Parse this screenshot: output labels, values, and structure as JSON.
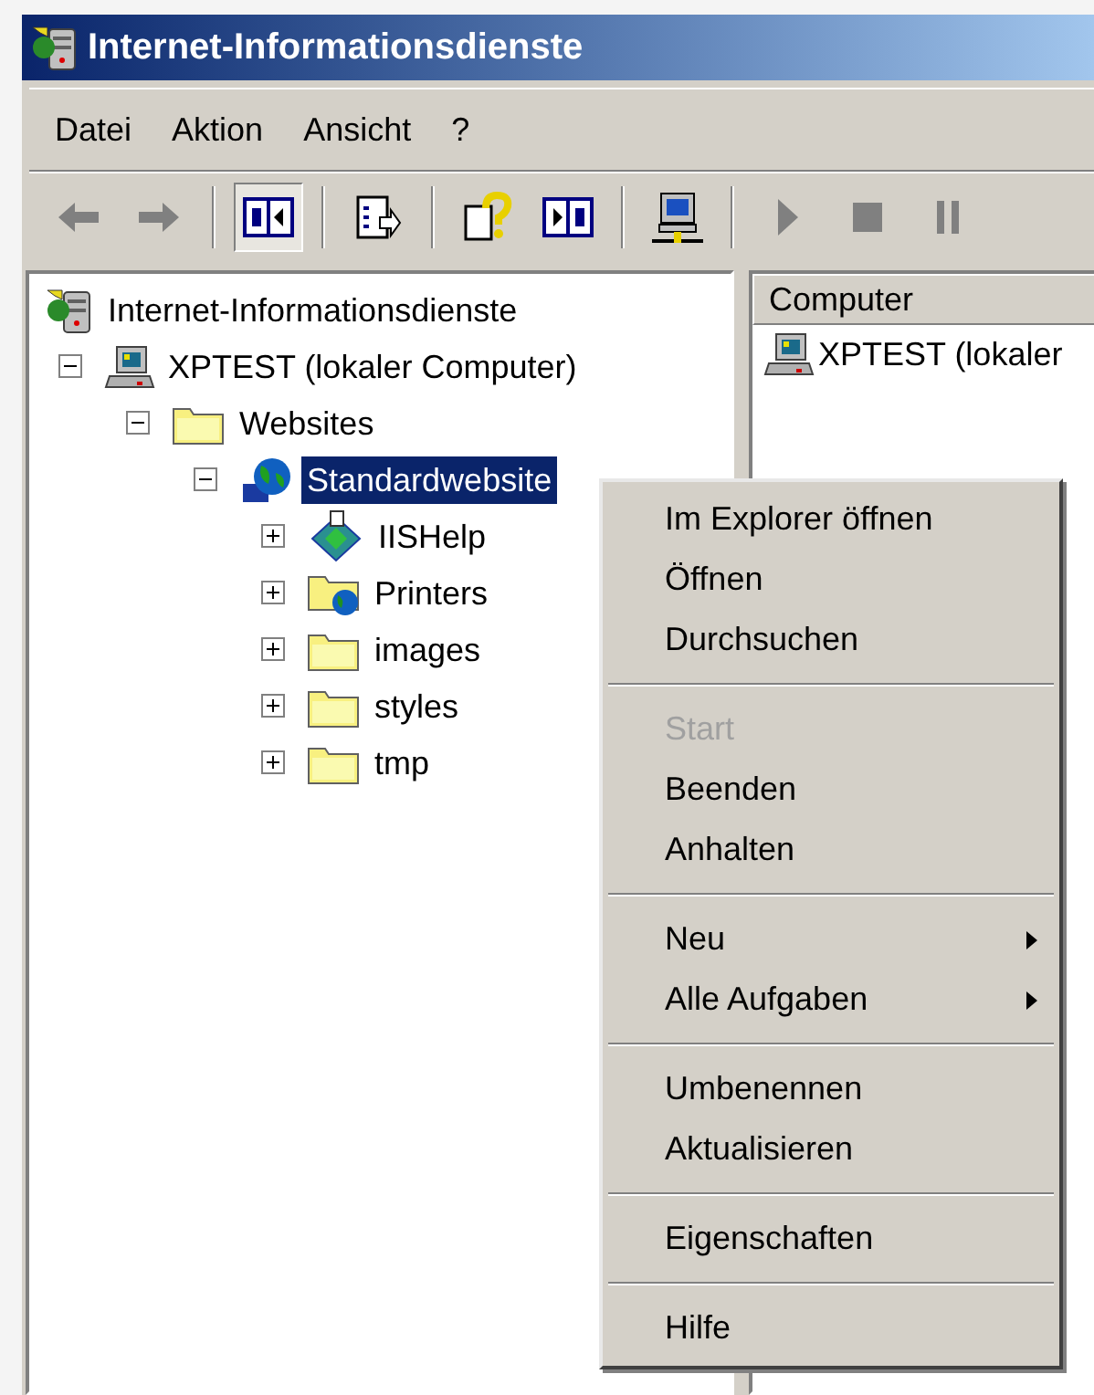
{
  "window": {
    "title": "Internet-Informationsdienste"
  },
  "menu_bar": [
    "Datei",
    "Aktion",
    "Ansicht",
    "?"
  ],
  "toolbar": [
    {
      "kind": "back",
      "disabled": true
    },
    {
      "kind": "forward",
      "disabled": true
    },
    {
      "kind": "separator"
    },
    {
      "kind": "tree",
      "pressed": true
    },
    {
      "kind": "separator"
    },
    {
      "kind": "export",
      "pressed": false
    },
    {
      "kind": "separator"
    },
    {
      "kind": "help",
      "pressed": false
    },
    {
      "kind": "pane",
      "pressed": false
    },
    {
      "kind": "separator"
    },
    {
      "kind": "computer",
      "pressed": false
    },
    {
      "kind": "separator"
    },
    {
      "kind": "play",
      "disabled": true
    },
    {
      "kind": "stop",
      "disabled": true
    },
    {
      "kind": "pause",
      "disabled": true
    }
  ],
  "tree": [
    {
      "label": "Internet-Informationsdienste",
      "kind": "iis",
      "selected": false,
      "children": [
        {
          "label": "XPTEST (lokaler Computer)",
          "kind": "computer",
          "selected": false,
          "expanded": true,
          "children": [
            {
              "label": "Websites",
              "kind": "folder",
              "selected": false,
              "expanded": true,
              "children": [
                {
                  "label": "Standardwebsite",
                  "kind": "site",
                  "selected": true,
                  "expanded": true,
                  "children": [
                    {
                      "label": "IISHelp",
                      "kind": "app",
                      "selected": false,
                      "expanded": false
                    },
                    {
                      "label": "Printers",
                      "kind": "webfolder",
                      "selected": false,
                      "expanded": false
                    },
                    {
                      "label": "images",
                      "kind": "folder",
                      "selected": false,
                      "expanded": false
                    },
                    {
                      "label": "styles",
                      "kind": "folder",
                      "selected": false,
                      "expanded": false
                    },
                    {
                      "label": "tmp",
                      "kind": "folder",
                      "selected": false,
                      "expanded": false
                    }
                  ]
                }
              ]
            }
          ]
        }
      ]
    }
  ],
  "list": {
    "columns": [
      "Computer"
    ],
    "rows": [
      {
        "label": "XPTEST (lokaler",
        "kind": "computer"
      }
    ]
  },
  "context_menu": [
    {
      "kind": "item",
      "label": "Im Explorer öffnen",
      "disabled": false
    },
    {
      "kind": "item",
      "label": "Öffnen",
      "disabled": false
    },
    {
      "kind": "item",
      "label": "Durchsuchen",
      "disabled": false
    },
    {
      "kind": "separator"
    },
    {
      "kind": "item",
      "label": "Start",
      "disabled": true
    },
    {
      "kind": "item",
      "label": "Beenden",
      "disabled": false
    },
    {
      "kind": "item",
      "label": "Anhalten",
      "disabled": false
    },
    {
      "kind": "separator"
    },
    {
      "kind": "submenu",
      "label": "Neu",
      "disabled": false
    },
    {
      "kind": "submenu",
      "label": "Alle Aufgaben",
      "disabled": false
    },
    {
      "kind": "separator"
    },
    {
      "kind": "item",
      "label": "Umbenennen",
      "disabled": false
    },
    {
      "kind": "item",
      "label": "Aktualisieren",
      "disabled": false
    },
    {
      "kind": "separator"
    },
    {
      "kind": "item",
      "label": "Eigenschaften",
      "disabled": false
    },
    {
      "kind": "separator"
    },
    {
      "kind": "item",
      "label": "Hilfe",
      "disabled": false
    }
  ]
}
